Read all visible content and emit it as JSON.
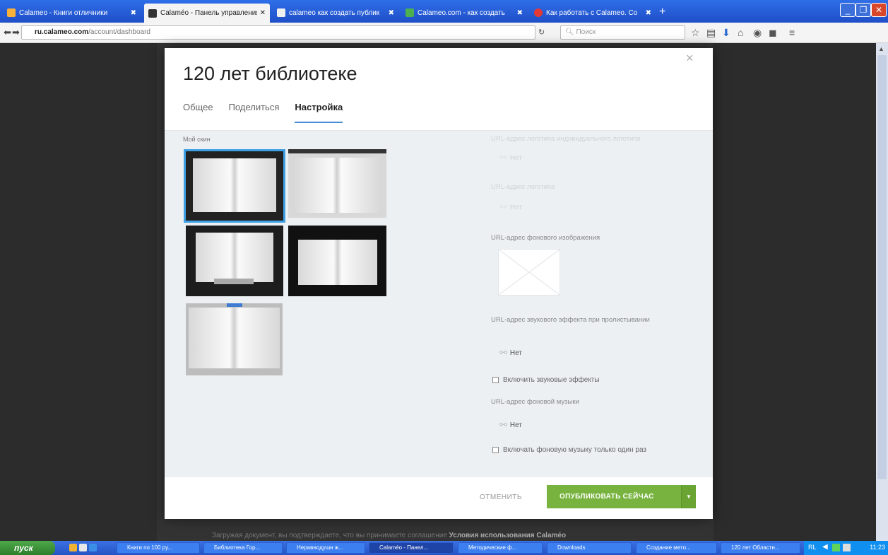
{
  "browser": {
    "tabs": [
      {
        "label": "Calameo - Книги отличники",
        "active": false
      },
      {
        "label": "Calaméo - Панель управления",
        "active": true
      },
      {
        "label": "calameo как создать публик",
        "active": false
      },
      {
        "label": "Calameo.com - как создать",
        "active": false
      },
      {
        "label": "Как работать с Calameo. Со",
        "active": false
      }
    ],
    "url_domain": "ru.calameo.com",
    "url_path": "/account/dashboard",
    "search_placeholder": "Поиск"
  },
  "modal": {
    "title": "120 лет библиотеке",
    "close_glyph": "×",
    "tabs": [
      {
        "label": "Общее",
        "active": false
      },
      {
        "label": "Поделиться",
        "active": false
      },
      {
        "label": "Настройка",
        "active": true
      }
    ],
    "skins_label": "Мой скин",
    "right": {
      "custom_logo_label": "URL-адрес логотипа индивидуального логотипа",
      "custom_logo_value": "Нет",
      "logo_url_label": "URL-адрес логотипа",
      "logo_url_value": "Нет",
      "bg_image_label": "URL-адрес фонового изображения",
      "sound_effect_label": "URL-адрес звукового эффекта при пролистывании",
      "sound_effect_value": "Нет",
      "enable_sound_label": "Включить звуковые эффекты",
      "bg_music_label": "URL-адрес фоновой музыки",
      "bg_music_value": "Нет",
      "music_once_label": "Включать фоновую музыку только один раз"
    },
    "cancel_label": "ОТМЕНИТЬ",
    "publish_label": "ОПУБЛИКОВАТЬ СЕЙЧАС"
  },
  "footer_note": {
    "text": "Загружая документ, вы подтверждаете, что вы принимаете соглашение",
    "link": "Условия использования Calaméo"
  },
  "taskbar": {
    "start_label": "пуск",
    "tasks": [
      {
        "label": "Книги по 100 ру..."
      },
      {
        "label": "Библиотека Гор..."
      },
      {
        "label": "Неравнодушн ж..."
      },
      {
        "label": "Calaméo - Панел..."
      },
      {
        "label": "Методические ф..."
      },
      {
        "label": "Downloads"
      },
      {
        "label": "Создание мето..."
      },
      {
        "label": "120 лет Областн..."
      }
    ],
    "clock": "11:23",
    "lang": "RL"
  },
  "colors": {
    "accent_green": "#77b33e",
    "tab_underline": "#4a8fd6",
    "taskbar_blue": "#2454c6"
  }
}
